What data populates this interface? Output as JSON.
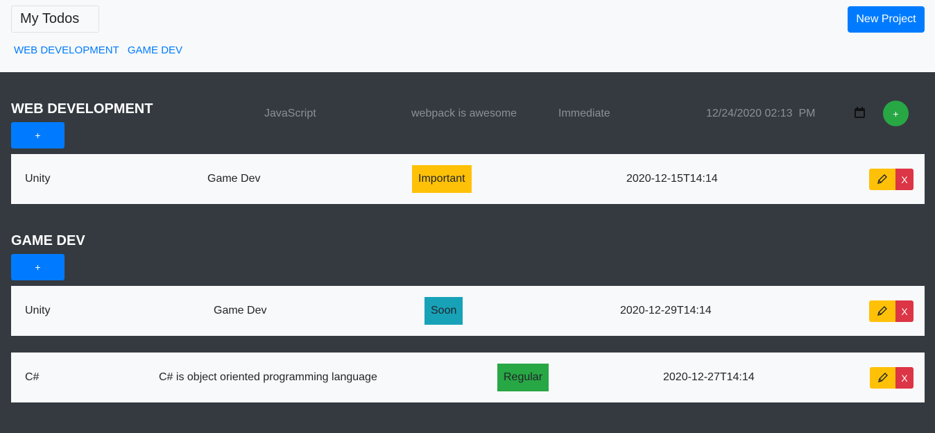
{
  "header": {
    "brand": "My Todos",
    "new_project_label": "New Project",
    "nav": [
      "WEB DEVELOPMENT",
      "GAME DEV"
    ]
  },
  "projects": [
    {
      "title": "WEB DEVELOPMENT",
      "add_label": "+",
      "form": {
        "title": "JavaScript",
        "description": "webpack is awesome",
        "priority": "Immediate",
        "date": "12/24/2020 02:13  PM",
        "submit_label": "+"
      },
      "todos": [
        {
          "title": "Unity",
          "description": "Game Dev",
          "priority": "Important",
          "date": "2020-12-15T14:14",
          "delete_label": "X"
        }
      ]
    },
    {
      "title": "GAME DEV",
      "add_label": "+",
      "todos": [
        {
          "title": "Unity",
          "description": "Game Dev",
          "priority": "Soon",
          "date": "2020-12-29T14:14",
          "delete_label": "X"
        },
        {
          "title": "C#",
          "description": "C# is object oriented programming language",
          "priority": "Regular",
          "date": "2020-12-27T14:14",
          "delete_label": "X"
        }
      ]
    }
  ],
  "colors": {
    "primary": "#007bff",
    "success": "#28a745",
    "warning": "#ffc107",
    "info": "#17a2b8",
    "danger": "#dc3545",
    "dark": "#343a40",
    "light": "#f8f9fa"
  },
  "icons": {
    "calendar": "calendar-icon",
    "edit": "pencil-icon"
  }
}
